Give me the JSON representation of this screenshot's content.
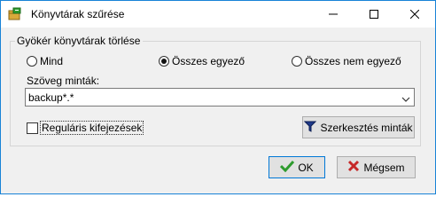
{
  "window": {
    "title": "Könyvtárak szűrése"
  },
  "titlebar_buttons": {
    "minimize": "minimize-icon",
    "maximize": "maximize-icon",
    "close": "close-icon"
  },
  "group": {
    "legend": "Gyökér könyvtárak törlése"
  },
  "radios": [
    {
      "label": "Mind",
      "selected": false
    },
    {
      "label": "Összes egyező",
      "selected": true
    },
    {
      "label": "Összes nem egyező",
      "selected": false
    }
  ],
  "pattern": {
    "label": "Szöveg minták:",
    "value": "backup*.*"
  },
  "regex": {
    "label": "Reguláris kifejezések",
    "checked": false
  },
  "buttons": {
    "edit_patterns": "Szerkesztés minták",
    "ok": "OK",
    "cancel": "Mégsem"
  },
  "colors": {
    "accent": "#0078d7",
    "filter_icon": "#1f3a8a",
    "ok_check": "#2e9b2e",
    "cancel_x": "#c62828"
  }
}
